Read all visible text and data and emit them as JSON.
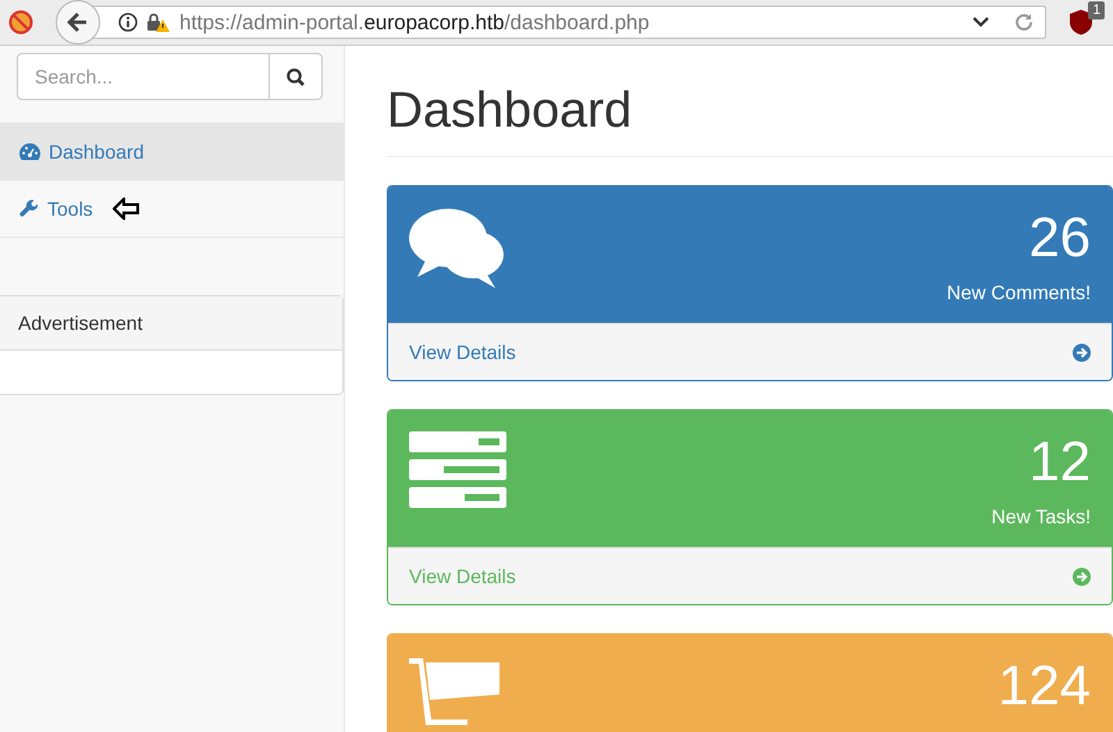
{
  "browser": {
    "url_start": "https://admin-portal.",
    "url_domain": "europacorp.htb",
    "url_end": "/dashboard.php",
    "extension_badge": "1"
  },
  "sidebar": {
    "search": {
      "placeholder": "Search..."
    },
    "items": [
      {
        "label": "Dashboard",
        "kind": "dashboard",
        "selected": true,
        "pointer_arrow": false
      },
      {
        "label": "Tools",
        "kind": "tools",
        "selected": false,
        "pointer_arrow": true
      }
    ],
    "panel": {
      "heading": "Advertisement"
    }
  },
  "main": {
    "title": "Dashboard",
    "cards": [
      {
        "kind": "comments",
        "color": "#337ab7",
        "count": "26",
        "caption": "New Comments!",
        "link": "View Details"
      },
      {
        "kind": "tasks",
        "color": "#5cb85c",
        "count": "12",
        "caption": "New Tasks!",
        "link": "View Details"
      },
      {
        "kind": "orders",
        "color": "#f0ad4e",
        "count": "124"
      }
    ]
  }
}
